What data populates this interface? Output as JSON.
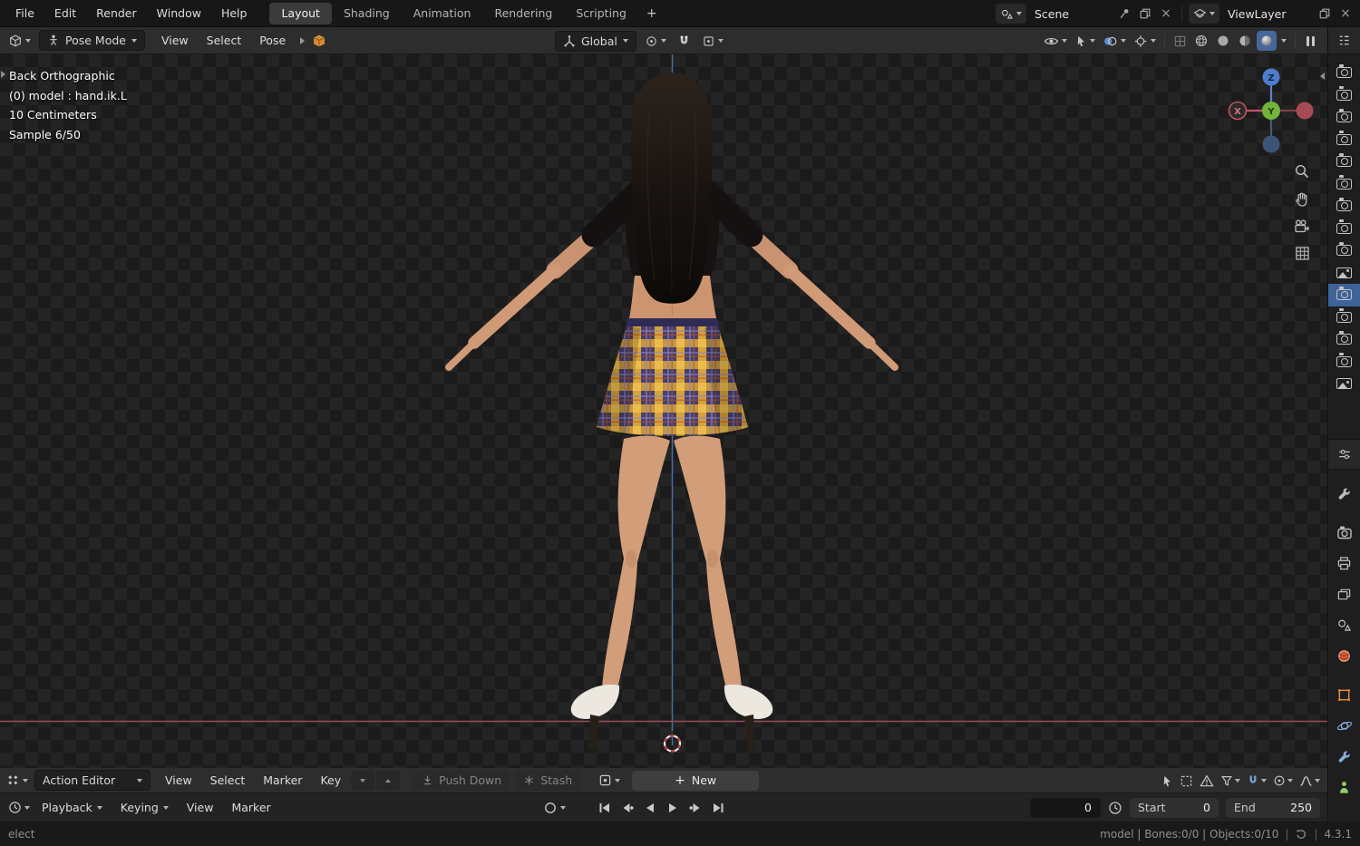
{
  "colors": {
    "accent": "#4772b3",
    "object_orange": "#e0883a",
    "axis_x": "#c4505a",
    "axis_y": "#6fb33f",
    "axis_z": "#5380d0",
    "skirt_gold": "#d7a23a",
    "skirt_navy": "#454070"
  },
  "topbar": {
    "menus": [
      "File",
      "Edit",
      "Render",
      "Window",
      "Help"
    ],
    "workspaces": [
      {
        "label": "Layout",
        "active": true
      },
      {
        "label": "Shading"
      },
      {
        "label": "Animation"
      },
      {
        "label": "Rendering"
      },
      {
        "label": "Scripting"
      }
    ],
    "add_workspace": "+",
    "scene_name": "Scene",
    "view_layer_name": "ViewLayer"
  },
  "viewport_header": {
    "mode": "Pose Mode",
    "menus": [
      "View",
      "Select",
      "Pose"
    ],
    "orientation": "Global"
  },
  "viewport": {
    "overlay_lines": [
      "Back Orthographic",
      "(0) model : hand.ik.L",
      "10 Centimeters",
      "Sample 6/50"
    ],
    "gizmo": {
      "x": "X",
      "y": "Y",
      "z": "Z"
    }
  },
  "outliner_rail": {
    "items": [
      "camera",
      "camera",
      "camera",
      "camera",
      "camera",
      "camera",
      "camera",
      "camera",
      "camera",
      "image",
      "camera-active",
      "camera",
      "camera",
      "camera",
      "image"
    ]
  },
  "properties_rail": {
    "tabs": [
      "tool",
      "render",
      "output",
      "view-layer",
      "scene",
      "world",
      "object",
      "physics",
      "modifiers",
      "data"
    ]
  },
  "dope_sheet": {
    "editor": "Action Editor",
    "menus": [
      "View",
      "Select",
      "Marker",
      "Key"
    ],
    "push_down": "Push Down",
    "stash": "Stash",
    "new": "New"
  },
  "timeline": {
    "playback": "Playback",
    "keying": "Keying",
    "menus": [
      "View",
      "Marker"
    ],
    "current_frame": "0",
    "start_label": "Start",
    "start_value": "0",
    "end_label": "End",
    "end_value": "250"
  },
  "status_bar": {
    "left": "elect",
    "stats": "model | Bones:0/0 | Objects:0/10",
    "version": "4.3.1"
  }
}
